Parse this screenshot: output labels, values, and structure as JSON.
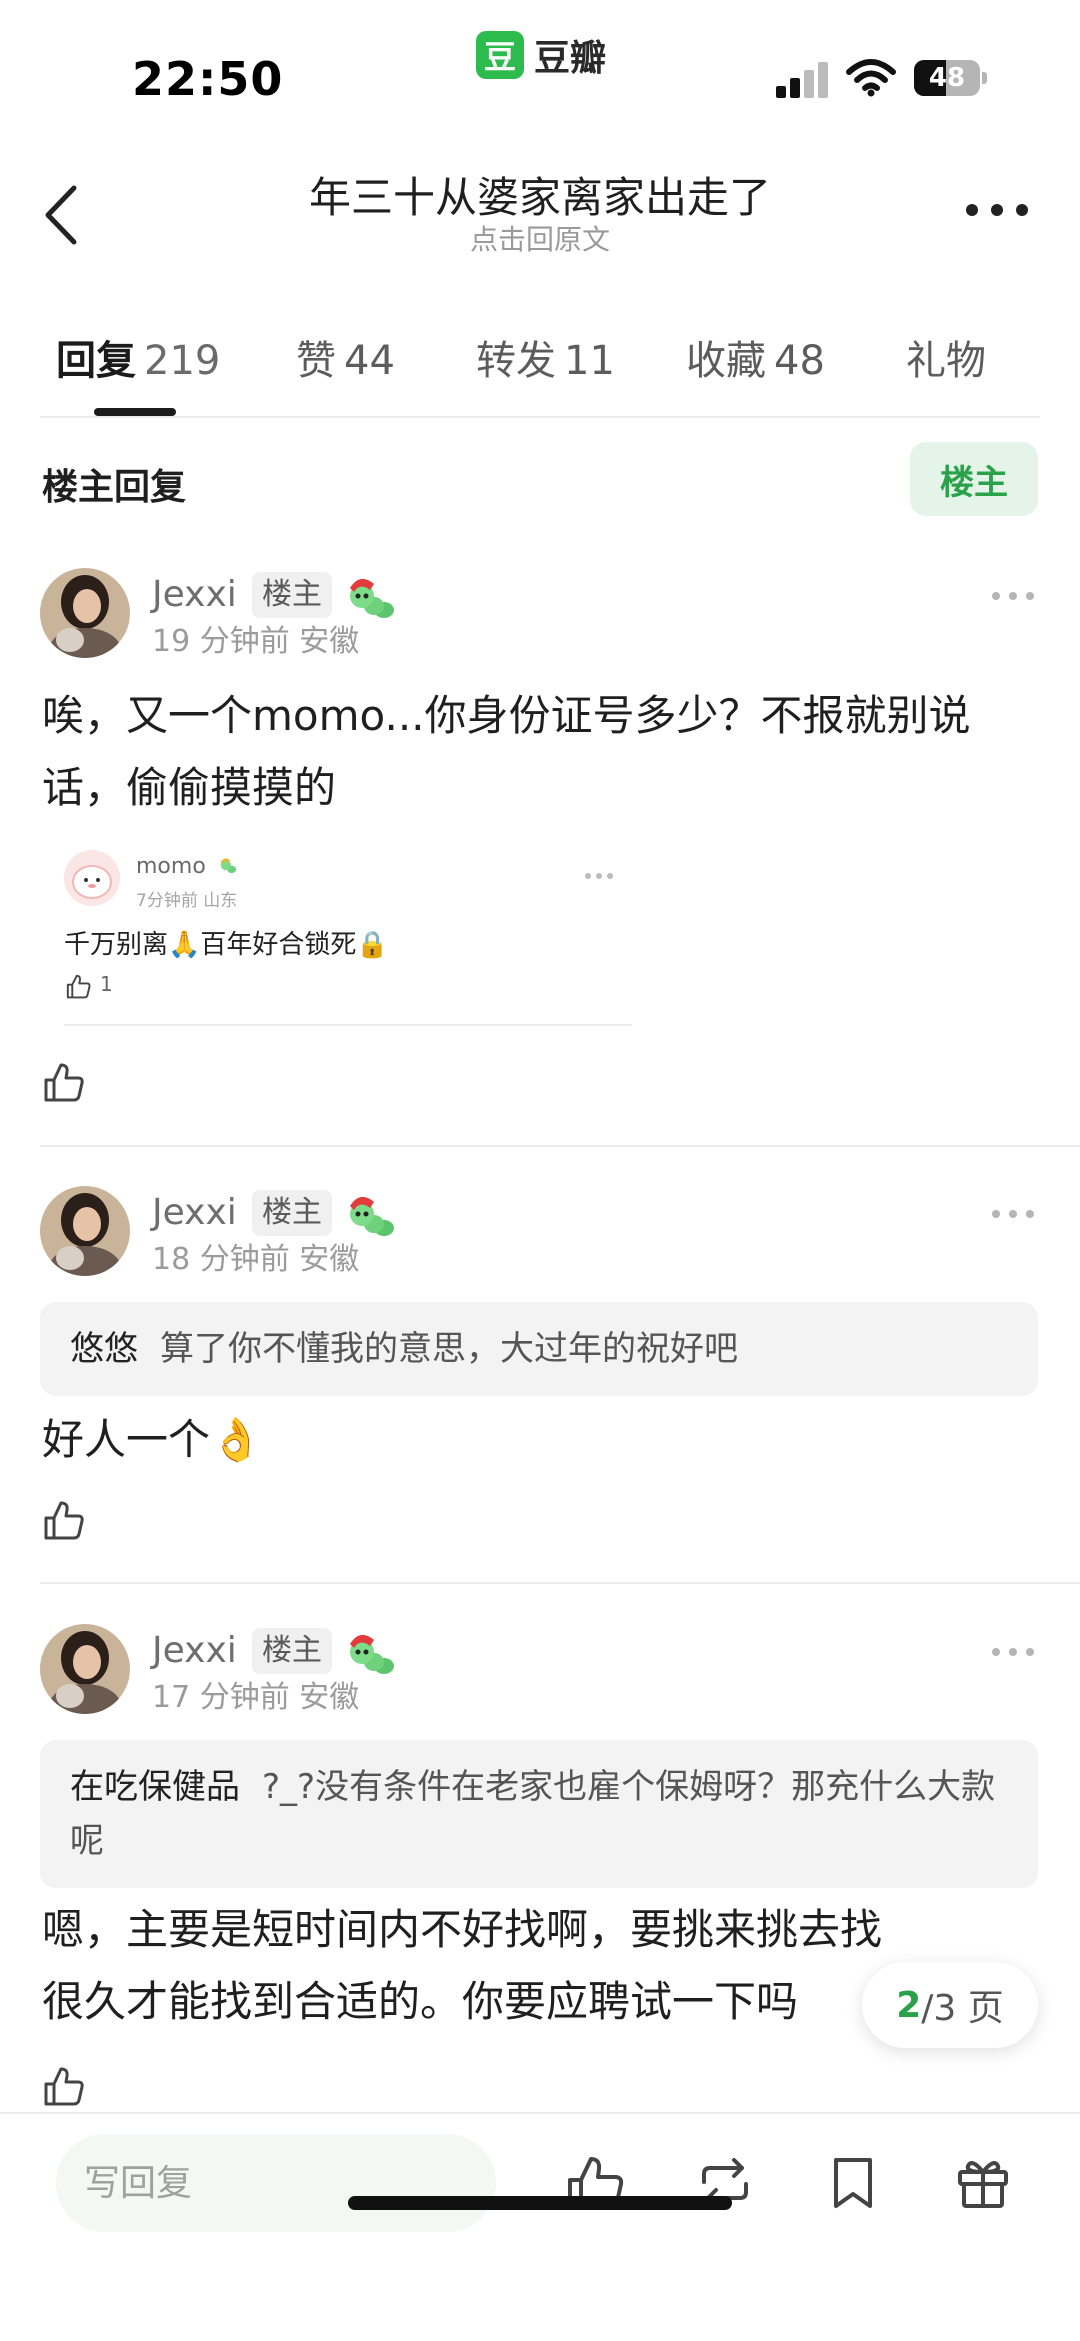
{
  "status_bar": {
    "time": "22:50",
    "app_logo_char": "豆",
    "app_name": "豆瓣",
    "battery": "48",
    "battery_level": 0.48
  },
  "header": {
    "title": "年三十从婆家离家出走了",
    "subtitle": "点击回原文"
  },
  "tabs": [
    {
      "label": "回复",
      "count": "219"
    },
    {
      "label": "赞",
      "count": "44"
    },
    {
      "label": "转发",
      "count": "11"
    },
    {
      "label": "收藏",
      "count": "48"
    },
    {
      "label": "礼物",
      "count": ""
    }
  ],
  "section": {
    "title": "楼主回复",
    "op_button": "楼主"
  },
  "comments": [
    {
      "user": "Jexxi",
      "tag": "楼主",
      "time": "19 分钟前",
      "location": "安徽",
      "text": "唉，又一个momo...你身份证号多少？不报就别说话，偷偷摸摸的",
      "nested": {
        "user": "momo",
        "time": "7分钟前",
        "location": "山东",
        "text": "千万别离🙏百年好合锁死🔒",
        "likes": "1"
      }
    },
    {
      "user": "Jexxi",
      "tag": "楼主",
      "time": "18 分钟前",
      "location": "安徽",
      "quote_user": "悠悠",
      "quote_text": "算了你不懂我的意思，大过年的祝好吧",
      "text": "好人一个👌"
    },
    {
      "user": "Jexxi",
      "tag": "楼主",
      "time": "17 分钟前",
      "location": "安徽",
      "quote_user": "在吃保健品",
      "quote_text": "?_?没有条件在老家也雇个保姆呀？那充什么大款呢",
      "text": "嗯，主要是短时间内不好找啊，要挑来挑去找很久才能找到合适的。你要应聘试一下吗"
    }
  ],
  "pagination": {
    "current": "2",
    "rest": "/3 页"
  },
  "bottom_bar": {
    "reply_placeholder": "写回复"
  },
  "colors": {
    "accent_green": "#2aa24a",
    "op_button_bg": "#e5f4e8",
    "divider": "#ececec"
  },
  "icons": [
    "back-icon",
    "more-icon",
    "thumbs-up-icon",
    "repost-icon",
    "bookmark-icon",
    "gift-icon",
    "caterpillar-badge-icon"
  ]
}
